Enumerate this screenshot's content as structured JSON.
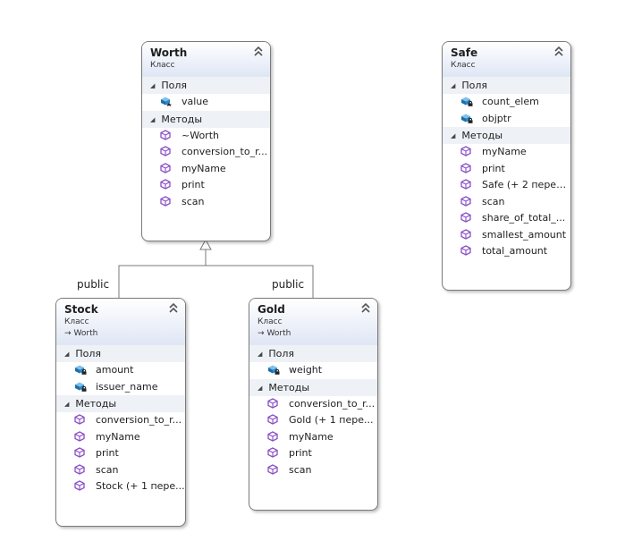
{
  "diagram": {
    "classes": {
      "worth": {
        "name": "Worth",
        "kind": "Класс",
        "fields_label": "Поля",
        "methods_label": "Методы",
        "fields": [
          "value"
        ],
        "methods": [
          "~Worth",
          "conversion_to_r...",
          "myName",
          "print",
          "scan"
        ]
      },
      "safe": {
        "name": "Safe",
        "kind": "Класс",
        "fields_label": "Поля",
        "methods_label": "Методы",
        "fields": [
          "count_elem",
          "objptr"
        ],
        "methods": [
          "myName",
          "print",
          "Safe (+ 2 перег...",
          "scan",
          "share_of_total_...",
          "smallest_amount",
          "total_amount"
        ]
      },
      "stock": {
        "name": "Stock",
        "kind": "Класс",
        "base": "Worth",
        "fields_label": "Поля",
        "methods_label": "Методы",
        "fields": [
          "amount",
          "issuer_name"
        ],
        "methods": [
          "conversion_to_r...",
          "myName",
          "print",
          "scan",
          "Stock (+ 1 пере..."
        ]
      },
      "gold": {
        "name": "Gold",
        "kind": "Класс",
        "base": "Worth",
        "fields_label": "Поля",
        "methods_label": "Методы",
        "fields": [
          "weight"
        ],
        "methods": [
          "conversion_to_r...",
          "Gold (+ 1 пере...",
          "myName",
          "print",
          "scan"
        ]
      }
    },
    "relations": [
      {
        "label": "public"
      },
      {
        "label": "public"
      }
    ],
    "colors": {
      "method": "#8a4fc7",
      "field": "#2a7ab5",
      "header": "#dfe6f5",
      "section": "#eef1f6"
    }
  }
}
